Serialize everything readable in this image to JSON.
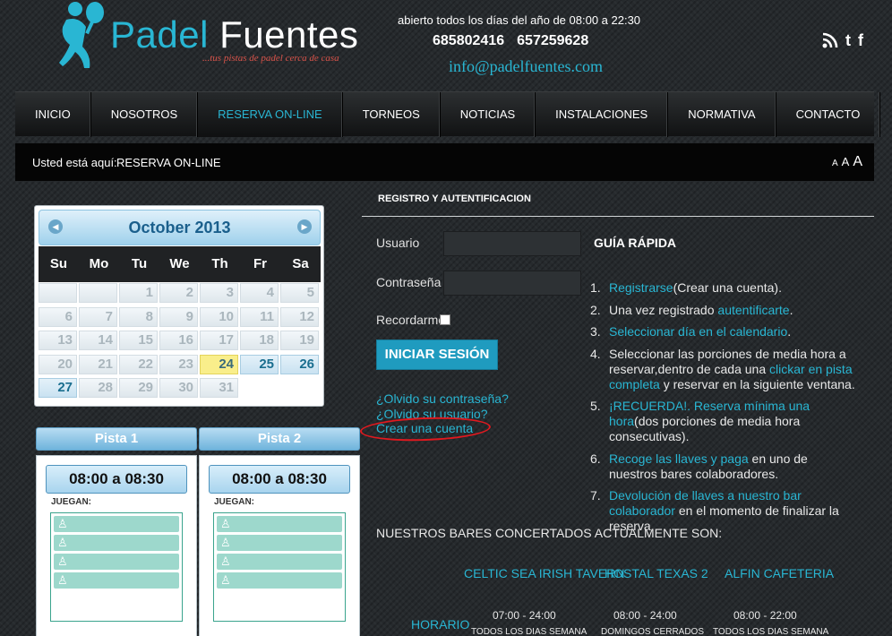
{
  "brand": {
    "logo_text_1": "Padel",
    "logo_text_2": "Fuentes",
    "tagline": "...tus pistas de padel cerca de casa"
  },
  "header": {
    "hours": "abierto todos los días del año de 08:00 a 22:30",
    "phone_1": "685802416",
    "phone_2": "657259628",
    "email": "info@padelfuentes.com",
    "social_icons": [
      "rss-icon",
      "twitter-icon",
      "facebook-icon"
    ]
  },
  "nav": {
    "items": [
      "INICIO",
      "NOSOTROS",
      "RESERVA ON-LINE",
      "TORNEOS",
      "NOTICIAS",
      "INSTALACIONES",
      "NORMATIVA",
      "CONTACTO"
    ],
    "active": "RESERVA ON-LINE"
  },
  "breadcrumb": {
    "label": "Usted está aquí:",
    "current": "RESERVA ON-LINE",
    "font_sizes": [
      "A",
      "A",
      "A"
    ]
  },
  "calendar": {
    "title": "October 2013",
    "prev_icon": "chevron-left-icon",
    "next_icon": "chevron-right-icon",
    "weekdays": [
      "Su",
      "Mo",
      "Tu",
      "We",
      "Th",
      "Fr",
      "Sa"
    ],
    "leading_blanks": 2,
    "days": [
      "1",
      "2",
      "3",
      "4",
      "5",
      "6",
      "7",
      "8",
      "9",
      "10",
      "11",
      "12",
      "13",
      "14",
      "15",
      "16",
      "17",
      "18",
      "19",
      "20",
      "21",
      "22",
      "23",
      "24",
      "25",
      "26",
      "27",
      "28",
      "29",
      "30",
      "31"
    ],
    "today": "24",
    "available": [
      "25",
      "26",
      "27"
    ]
  },
  "pistas": [
    {
      "name": "Pista 1",
      "slot": "08:00 a 08:30",
      "juegan_label": "JUEGAN:"
    },
    {
      "name": "Pista 2",
      "slot": "08:00 a 08:30",
      "juegan_label": "JUEGAN:"
    }
  ],
  "login": {
    "section_title": "REGISTRO Y AUTENTIFICACION",
    "username_label": "Usuario",
    "username_value": "",
    "password_label": "Contraseña",
    "password_value": "",
    "remember_label": "Recordarme",
    "submit_label": "INICIAR SESIÓN",
    "forgot_password": "¿Olvido su contraseña?",
    "forgot_username": "¿Olvido su usuario?",
    "create_account": "Crear una cuenta"
  },
  "guide": {
    "title": "GUÍA RÁPIDA",
    "steps": [
      {
        "n": "1.",
        "link": "Registrarse",
        "text": "(Crear una cuenta)."
      },
      {
        "n": "2.",
        "text": "Una vez registrado ",
        "link": "autentificarte",
        "text2": "."
      },
      {
        "n": "3.",
        "link": "Seleccionar día en el calendario",
        "text": "."
      },
      {
        "n": "4.",
        "text": "Seleccionar las porciones de media hora a reservar,dentro de cada una ",
        "link": "clickar en pista completa",
        "text2": " y reservar en la siguiente ventana."
      },
      {
        "n": "5.",
        "link": "¡RECUERDA!. Reserva mínima una hora",
        "text": "(dos porciones de media hora consecutivas)."
      },
      {
        "n": "6.",
        "link": "Recoge las llaves y paga",
        "text": " en uno de nuestros bares colaboradores."
      },
      {
        "n": "7.",
        "link": "Devolución de llaves a nuestro bar colaborador",
        "text": " en el momento de finalizar la reserva."
      }
    ]
  },
  "bars": {
    "title": "NUESTROS BARES CONCERTADOS ACTUALMENTE SON:",
    "horario_label": "HORARIO",
    "items": [
      {
        "name": "CELTIC SEA IRISH TAVERN",
        "hours": "07:00 - 24:00",
        "days": "TODOS LOS DIAS SEMANA"
      },
      {
        "name": "HOSTAL TEXAS 2",
        "hours": "08:00 - 24:00",
        "days": "DOMINGOS CERRADOS"
      },
      {
        "name": "ALFIN CAFETERIA",
        "hours": "08:00 - 22:00",
        "days": "TODOS LOS DIAS SEMANA"
      }
    ]
  },
  "colors": {
    "accent": "#29b6d3",
    "annotation": "#e0191f"
  }
}
